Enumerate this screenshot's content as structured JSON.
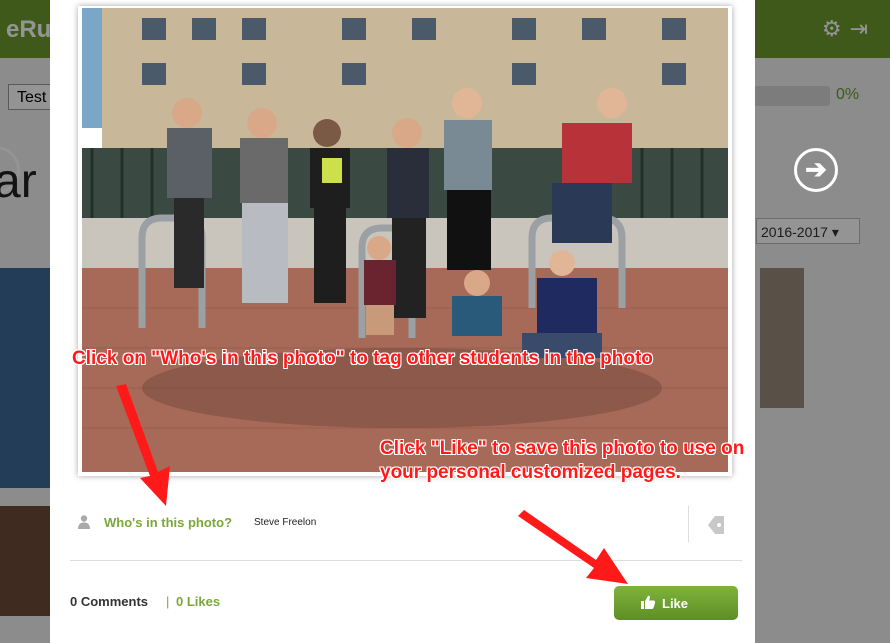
{
  "background": {
    "logo_fragment": "eRu",
    "tab_fragment": "Test",
    "progress_percent": "0%",
    "title_fragment": "ar",
    "year_select": "2016-2017 ▾",
    "next_arrow": "➔"
  },
  "photo": {
    "alt": "Group of children posing on a bike rack"
  },
  "tag_row": {
    "who_link": "Who's in this photo?",
    "tagged_name": "Steve Freelon"
  },
  "footer": {
    "comments": "0 Comments",
    "separator": "|",
    "likes": "0 Likes",
    "like_button": "Like"
  },
  "annotations": {
    "tag_instruction": "Click on \"Who's in this photo\" to tag other students in the photo",
    "like_instruction_line1": "Click \"Like\" to save this photo to use on",
    "like_instruction_line2": "your personal customized pages."
  },
  "colors": {
    "brand_green": "#6b9a2c",
    "link_green": "#7aa83a",
    "annotation_red": "#ff1a1a"
  }
}
